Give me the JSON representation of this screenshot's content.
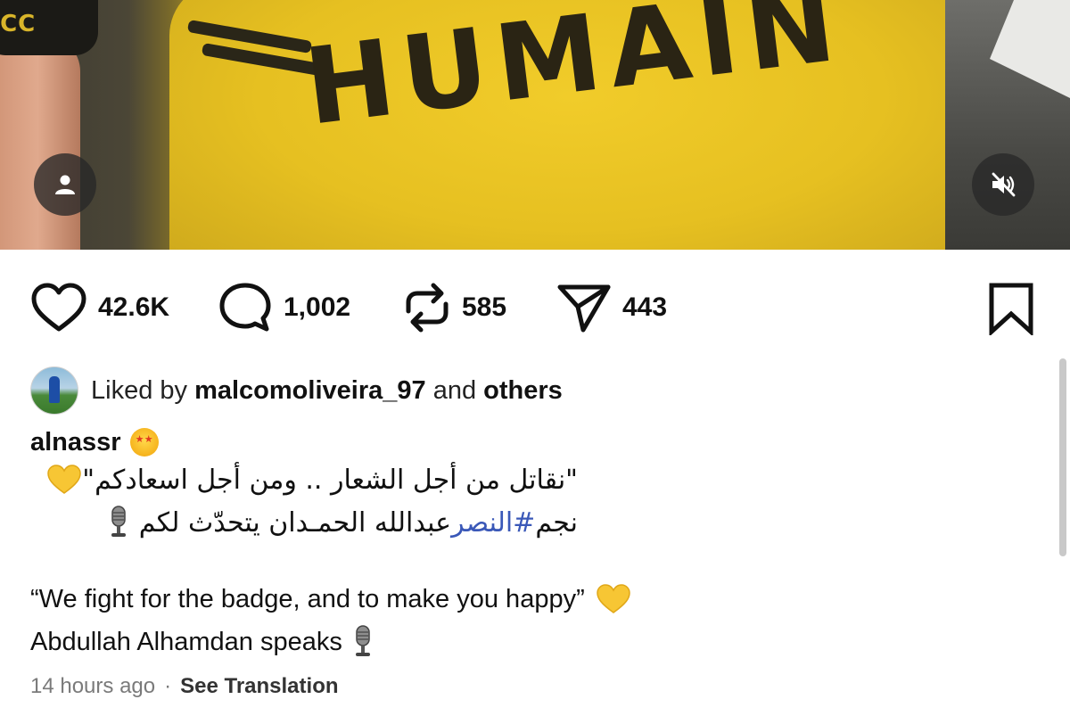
{
  "media": {
    "shirt_text": "HUMAIN",
    "armband_text": "CCC"
  },
  "icons": {
    "profile": "person-icon",
    "mute": "muted-speaker-icon",
    "like": "heart-outline-icon",
    "comment": "comment-bubble-icon",
    "repost": "repost-arrows-icon",
    "share": "paper-plane-icon",
    "save": "bookmark-outline-icon"
  },
  "actions": {
    "likes": "42.6K",
    "comments": "1,002",
    "reposts": "585",
    "shares": "443"
  },
  "liked_by": {
    "prefix": "Liked by",
    "user": "malcomoliveira_97",
    "middle": "and",
    "others": "others"
  },
  "caption": {
    "username": "alnassr",
    "arabic_line1": "\"نقاتل من أجل الشعار .. ومن أجل اسعادكم\"",
    "arabic_line2_prefix": "نجم ",
    "arabic_hashtag": "#النصر",
    "arabic_line2_suffix": " عبدالله الحمـدان يتحدّث لكم",
    "english_line1": "“We fight for the badge, and to make you happy”",
    "english_line2": "Abdullah Alhamdan speaks"
  },
  "meta": {
    "time": "14 hours ago",
    "separator": "·",
    "translate": "See Translation"
  },
  "colors": {
    "hashtag": "#3a58b8",
    "meta_gray": "#7a7a7a",
    "shirt_yellow": "#e6c021"
  }
}
